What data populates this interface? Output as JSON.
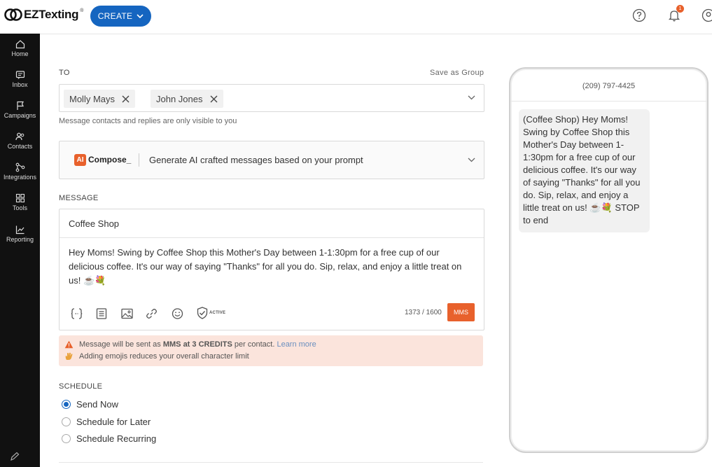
{
  "app": {
    "logo_text": "EZTexting",
    "logo_mark": "®"
  },
  "header": {
    "create_label": "CREATE",
    "notifications_count": "1",
    "icons": [
      "help-icon",
      "bell-icon",
      "user-icon"
    ]
  },
  "sidebar": {
    "items": [
      {
        "label": "Home",
        "icon": "home-icon"
      },
      {
        "label": "Inbox",
        "icon": "inbox-icon"
      },
      {
        "label": "Campaigns",
        "icon": "flag-icon"
      },
      {
        "label": "Contacts",
        "icon": "contacts-icon"
      },
      {
        "label": "Integrations",
        "icon": "integrations-icon"
      },
      {
        "label": "Tools",
        "icon": "tools-icon"
      },
      {
        "label": "Reporting",
        "icon": "chart-icon"
      }
    ]
  },
  "to": {
    "label": "TO",
    "save_group": "Save as Group",
    "recipients": [
      "Molly Mays",
      "John Jones"
    ],
    "hint": "Message contacts and replies are only visible to you"
  },
  "compose": {
    "ai_badge": "AI",
    "name": "Compose_",
    "description": "Generate AI crafted messages based on your prompt"
  },
  "message": {
    "label": "MESSAGE",
    "title_value": "Coffee Shop",
    "body": "Hey Moms! Swing by Coffee Shop this Mother's Day between 1-1:30pm for a free cup of our delicious coffee. It's our way of saying \"Thanks\" for all you do. Sip, relax, and enjoy a little treat on us! ☕💐",
    "active_label": "ACTIVE",
    "char_count": "1373 / 1600",
    "mms_label": "MMS"
  },
  "warning": {
    "line1_prefix": "Message will be sent as ",
    "line1_bold": "MMS at 3 CREDITS",
    "line1_suffix": " per contact. ",
    "learn_more": "Learn more",
    "line2": "Adding emojis reduces your overall character limit"
  },
  "schedule": {
    "label": "SCHEDULE",
    "options": [
      "Send Now",
      "Schedule for Later",
      "Schedule Recurring"
    ],
    "selected": "Send Now"
  },
  "preview": {
    "phone_number": "(209) 797-4425",
    "bubble_text": "(Coffee Shop) Hey Moms! Swing by Coffee Shop this Mother's Day between 1-1:30pm for a free cup of our delicious coffee. It's our way of saying \"Thanks\" for all you do. Sip, relax, and enjoy a little treat on us! ☕💐 STOP to end"
  },
  "colors": {
    "primary": "#1565c0",
    "accent": "#e8612c",
    "sidebar": "#111111",
    "warning_bg": "#fbe4dc"
  }
}
